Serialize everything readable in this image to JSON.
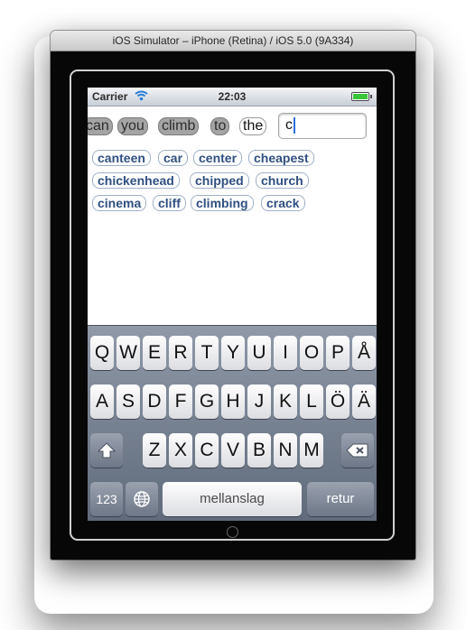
{
  "window": {
    "title": "iOS Simulator – iPhone (Retina) / iOS 5.0 (9A334)"
  },
  "statusbar": {
    "carrier": "Carrier",
    "time": "22:03",
    "battery_level": 1.0
  },
  "sentence": {
    "words": [
      "can",
      "you",
      "climb",
      "to",
      "the"
    ],
    "input_value": "c"
  },
  "suggestions": [
    [
      "canteen",
      "car",
      "center",
      "cheapest"
    ],
    [
      "chickenhead",
      "chipped",
      "church"
    ],
    [
      "cinema",
      "cliff",
      "climbing",
      "crack"
    ]
  ],
  "keyboard": {
    "row1": [
      "Q",
      "W",
      "E",
      "R",
      "T",
      "Y",
      "U",
      "I",
      "O",
      "P",
      "Å"
    ],
    "row2": [
      "A",
      "S",
      "D",
      "F",
      "G",
      "H",
      "J",
      "K",
      "L",
      "Ö",
      "Ä"
    ],
    "row3": [
      "Z",
      "X",
      "C",
      "V",
      "B",
      "N",
      "M"
    ],
    "numbers_label": "123",
    "space_label": "mellanslag",
    "return_label": "retur",
    "shift_icon": "shift-arrow-icon",
    "backspace_icon": "backspace-icon",
    "globe_icon": "globe-icon"
  },
  "colors": {
    "chip_text": "#2f4f80",
    "battery": "#39c63a",
    "caret": "#2b6fdc"
  }
}
